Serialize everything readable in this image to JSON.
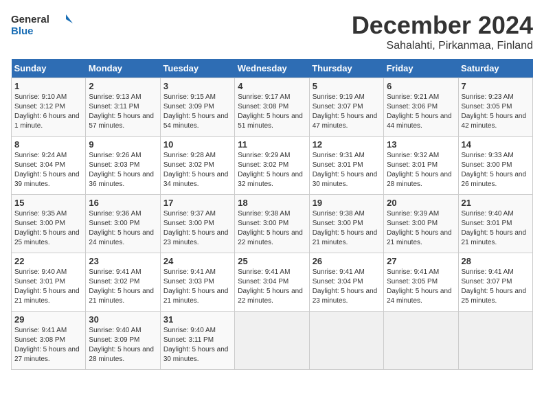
{
  "header": {
    "logo_general": "General",
    "logo_blue": "Blue",
    "title": "December 2024",
    "subtitle": "Sahalahti, Pirkanmaa, Finland"
  },
  "weekdays": [
    "Sunday",
    "Monday",
    "Tuesday",
    "Wednesday",
    "Thursday",
    "Friday",
    "Saturday"
  ],
  "weeks": [
    [
      {
        "day": "1",
        "sunrise": "9:10 AM",
        "sunset": "3:12 PM",
        "daylight": "6 hours and 1 minute."
      },
      {
        "day": "2",
        "sunrise": "9:13 AM",
        "sunset": "3:11 PM",
        "daylight": "5 hours and 57 minutes."
      },
      {
        "day": "3",
        "sunrise": "9:15 AM",
        "sunset": "3:09 PM",
        "daylight": "5 hours and 54 minutes."
      },
      {
        "day": "4",
        "sunrise": "9:17 AM",
        "sunset": "3:08 PM",
        "daylight": "5 hours and 51 minutes."
      },
      {
        "day": "5",
        "sunrise": "9:19 AM",
        "sunset": "3:07 PM",
        "daylight": "5 hours and 47 minutes."
      },
      {
        "day": "6",
        "sunrise": "9:21 AM",
        "sunset": "3:06 PM",
        "daylight": "5 hours and 44 minutes."
      },
      {
        "day": "7",
        "sunrise": "9:23 AM",
        "sunset": "3:05 PM",
        "daylight": "5 hours and 42 minutes."
      }
    ],
    [
      {
        "day": "8",
        "sunrise": "9:24 AM",
        "sunset": "3:04 PM",
        "daylight": "5 hours and 39 minutes."
      },
      {
        "day": "9",
        "sunrise": "9:26 AM",
        "sunset": "3:03 PM",
        "daylight": "5 hours and 36 minutes."
      },
      {
        "day": "10",
        "sunrise": "9:28 AM",
        "sunset": "3:02 PM",
        "daylight": "5 hours and 34 minutes."
      },
      {
        "day": "11",
        "sunrise": "9:29 AM",
        "sunset": "3:02 PM",
        "daylight": "5 hours and 32 minutes."
      },
      {
        "day": "12",
        "sunrise": "9:31 AM",
        "sunset": "3:01 PM",
        "daylight": "5 hours and 30 minutes."
      },
      {
        "day": "13",
        "sunrise": "9:32 AM",
        "sunset": "3:01 PM",
        "daylight": "5 hours and 28 minutes."
      },
      {
        "day": "14",
        "sunrise": "9:33 AM",
        "sunset": "3:00 PM",
        "daylight": "5 hours and 26 minutes."
      }
    ],
    [
      {
        "day": "15",
        "sunrise": "9:35 AM",
        "sunset": "3:00 PM",
        "daylight": "5 hours and 25 minutes."
      },
      {
        "day": "16",
        "sunrise": "9:36 AM",
        "sunset": "3:00 PM",
        "daylight": "5 hours and 24 minutes."
      },
      {
        "day": "17",
        "sunrise": "9:37 AM",
        "sunset": "3:00 PM",
        "daylight": "5 hours and 23 minutes."
      },
      {
        "day": "18",
        "sunrise": "9:38 AM",
        "sunset": "3:00 PM",
        "daylight": "5 hours and 22 minutes."
      },
      {
        "day": "19",
        "sunrise": "9:38 AM",
        "sunset": "3:00 PM",
        "daylight": "5 hours and 21 minutes."
      },
      {
        "day": "20",
        "sunrise": "9:39 AM",
        "sunset": "3:00 PM",
        "daylight": "5 hours and 21 minutes."
      },
      {
        "day": "21",
        "sunrise": "9:40 AM",
        "sunset": "3:01 PM",
        "daylight": "5 hours and 21 minutes."
      }
    ],
    [
      {
        "day": "22",
        "sunrise": "9:40 AM",
        "sunset": "3:01 PM",
        "daylight": "5 hours and 21 minutes."
      },
      {
        "day": "23",
        "sunrise": "9:41 AM",
        "sunset": "3:02 PM",
        "daylight": "5 hours and 21 minutes."
      },
      {
        "day": "24",
        "sunrise": "9:41 AM",
        "sunset": "3:03 PM",
        "daylight": "5 hours and 21 minutes."
      },
      {
        "day": "25",
        "sunrise": "9:41 AM",
        "sunset": "3:04 PM",
        "daylight": "5 hours and 22 minutes."
      },
      {
        "day": "26",
        "sunrise": "9:41 AM",
        "sunset": "3:04 PM",
        "daylight": "5 hours and 23 minutes."
      },
      {
        "day": "27",
        "sunrise": "9:41 AM",
        "sunset": "3:05 PM",
        "daylight": "5 hours and 24 minutes."
      },
      {
        "day": "28",
        "sunrise": "9:41 AM",
        "sunset": "3:07 PM",
        "daylight": "5 hours and 25 minutes."
      }
    ],
    [
      {
        "day": "29",
        "sunrise": "9:41 AM",
        "sunset": "3:08 PM",
        "daylight": "5 hours and 27 minutes."
      },
      {
        "day": "30",
        "sunrise": "9:40 AM",
        "sunset": "3:09 PM",
        "daylight": "5 hours and 28 minutes."
      },
      {
        "day": "31",
        "sunrise": "9:40 AM",
        "sunset": "3:11 PM",
        "daylight": "5 hours and 30 minutes."
      },
      null,
      null,
      null,
      null
    ]
  ]
}
